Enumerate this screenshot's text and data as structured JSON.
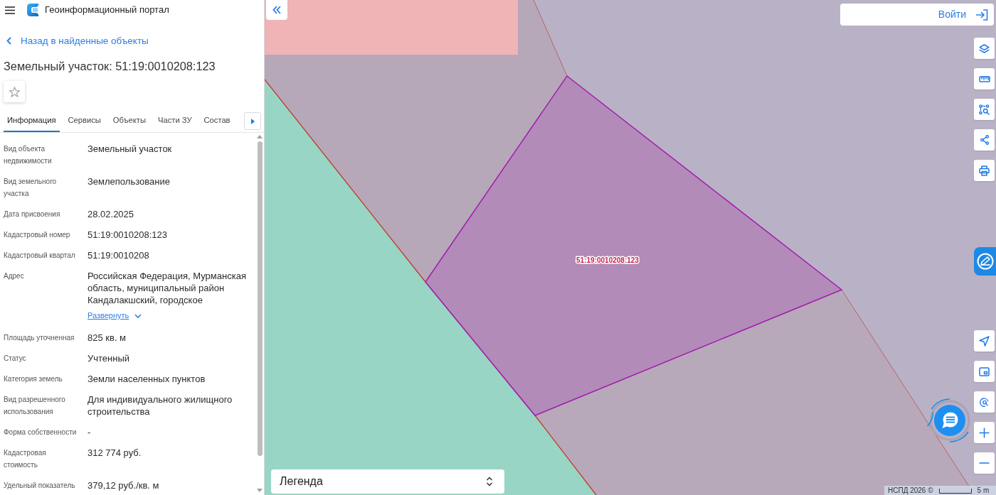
{
  "header": {
    "title": "Геоинформационный портал"
  },
  "panel": {
    "back_link": "Назад в найденные объекты",
    "title": "Земельный участок: 51:19:0010208:123",
    "starred": false
  },
  "tabs": [
    {
      "label": "Информация",
      "selected": true
    },
    {
      "label": "Сервисы",
      "selected": false
    },
    {
      "label": "Объекты",
      "selected": false
    },
    {
      "label": "Части ЗУ",
      "selected": false
    },
    {
      "label": "Состав",
      "selected": false
    }
  ],
  "properties": [
    {
      "label": "Вид объекта недвижимости",
      "value": "Земельный участок"
    },
    {
      "label": "Вид земельного участка",
      "value": "Землепользование"
    },
    {
      "label": "Дата присвоения",
      "value": "28.02.2025"
    },
    {
      "label": "Кадастровый номер",
      "value": "51:19:0010208:123"
    },
    {
      "label": "Кадастровый квартал",
      "value": "51:19:0010208"
    },
    {
      "label": "Адрес",
      "value": "Российская Федерация, Мурманская область, муниципальный район Кандалакшский, городское",
      "expand": {
        "label": "Развернуть",
        "expanded": false
      }
    },
    {
      "label": "Площадь уточненная",
      "value": "825 кв. м"
    },
    {
      "label": "Статус",
      "value": "Учтенный"
    },
    {
      "label": "Категория земель",
      "value": "Земли населенных пунктов"
    },
    {
      "label": "Вид разрешенного использования",
      "value": "Для индивидуального жилищного строительства"
    },
    {
      "label": "Форма собственности",
      "value": "-"
    },
    {
      "label": "Кадастровая стоимость",
      "value": "312 774 руб."
    },
    {
      "label": "Удельный показатель",
      "value": "379,12 руб./кв. м"
    }
  ],
  "map": {
    "plot_label": "51:19:0010208:123",
    "login_button": "Войти",
    "legend": "Легенда",
    "attribution": "НСПД 2026 ©",
    "scale": "5 m"
  }
}
